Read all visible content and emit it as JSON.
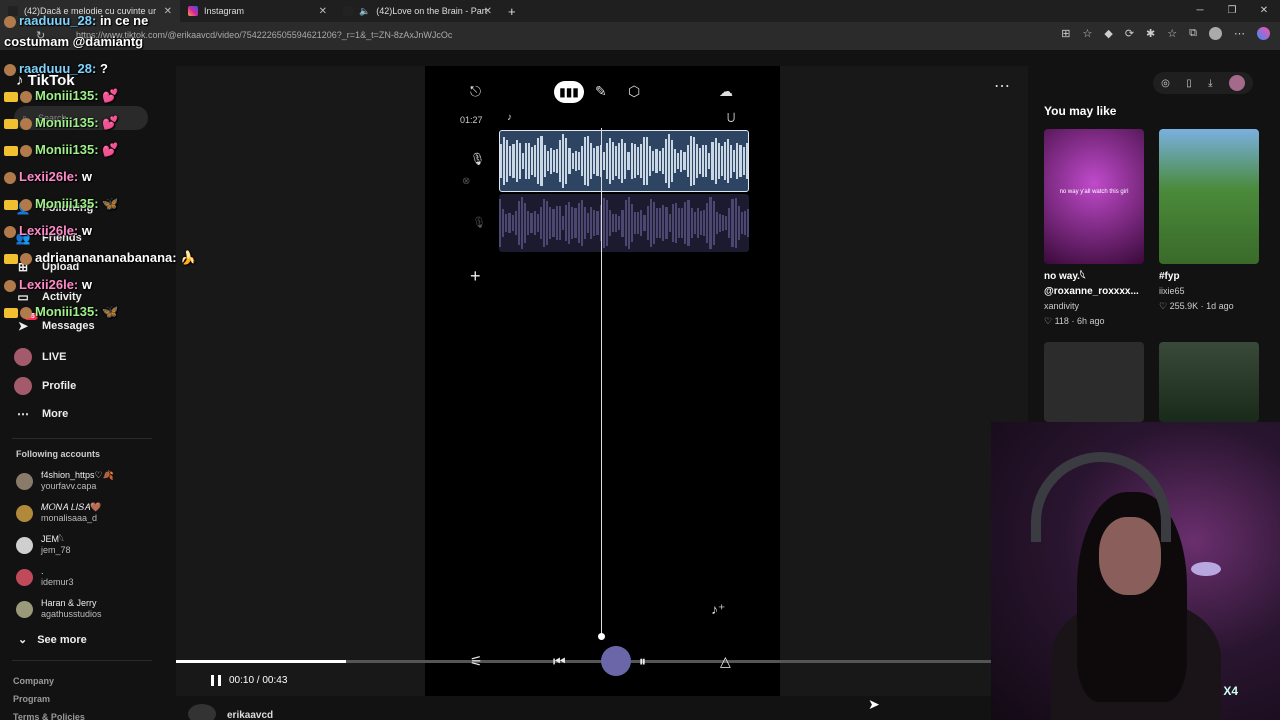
{
  "browser": {
    "tabs": [
      {
        "label": "(42)Dacă e melodie cu cuvinte ur",
        "active": true
      },
      {
        "label": "Instagram",
        "active": false
      },
      {
        "label": "(42)Love on the Brain - Part",
        "active": false
      }
    ],
    "new_tab": "+",
    "url": "https://www.tiktok.com/@erikaavcd/video/7542226505594621206?_r=1&_t=ZN-8zAxJnWJcOc"
  },
  "chat": [
    {
      "user": "raaduuu_28:",
      "msg": "in ce ne",
      "color": "#7fd4ff"
    },
    {
      "user": "costumam @damiantg",
      "msg": "",
      "color": "#ffffff"
    },
    {
      "user": "raaduuu_28:",
      "msg": "?",
      "color": "#7fd4ff"
    },
    {
      "user": "Moniii135:",
      "msg": "💕",
      "color": "#9ef08a"
    },
    {
      "user": "Moniii135:",
      "msg": "💕",
      "color": "#9ef08a"
    },
    {
      "user": "Moniii135:",
      "msg": "💕",
      "color": "#9ef08a"
    },
    {
      "user": "Lexii26le:",
      "msg": "w",
      "color": "#ff8ac8"
    },
    {
      "user": "Moniii135:",
      "msg": "🦋",
      "color": "#9ef08a"
    },
    {
      "user": "Lexii26le:",
      "msg": "w",
      "color": "#ff8ac8"
    },
    {
      "user": "adriananananabanana:",
      "msg": "🍌",
      "color": "#ffffff"
    },
    {
      "user": "Lexii26le:",
      "msg": "w",
      "color": "#ff8ac8"
    },
    {
      "user": "Moniii135:",
      "msg": "🦋",
      "color": "#9ef08a"
    }
  ],
  "sidebar": {
    "logo": "TikTok",
    "search_placeholder": "Search",
    "nav": [
      {
        "label": "Following",
        "icon": "user-icon"
      },
      {
        "label": "Friends",
        "icon": "friends-icon"
      },
      {
        "label": "Upload",
        "icon": "upload-icon"
      },
      {
        "label": "Activity",
        "icon": "activity-icon"
      },
      {
        "label": "Messages",
        "icon": "messages-icon"
      },
      {
        "label": "LIVE",
        "icon": "live-icon"
      },
      {
        "label": "Profile",
        "icon": "profile-icon"
      },
      {
        "label": "More",
        "icon": "more-icon"
      }
    ],
    "messages_badge": "35",
    "following_title": "Following accounts",
    "accounts": [
      {
        "name": "f4shion_https♡🍂",
        "handle": "yourfavv.capa"
      },
      {
        "name": "𝑀𝑂𝑁𝐴 𝐿𝐼𝑆𝐴🤎",
        "handle": "monalisaaa_d"
      },
      {
        "name": "JEM𓆩",
        "handle": "jem_78"
      },
      {
        "name": ".",
        "handle": "idemur3"
      },
      {
        "name": "Haran & Jerry",
        "handle": "agathusstudios"
      }
    ],
    "see_more": "See more",
    "footer": [
      "Company",
      "Program",
      "Terms & Policies"
    ]
  },
  "player": {
    "timecode_top": "01:27",
    "current": "00:10",
    "duration": "00:43",
    "progress": 0.2,
    "author": "erikaavcd"
  },
  "right": {
    "you_may_like": "You may like",
    "videos": [
      {
        "title": "no way.𓆩",
        "subtitle": "@roxanne_roxxxx...",
        "author": "xandivity",
        "stats": "118 · 6h ago",
        "thumb_text": "no way y'all watch this girl",
        "bg": "#7a2a7a"
      },
      {
        "title": "#fyp",
        "subtitle": "",
        "author": "iixie65",
        "stats": "255.9K · 1d ago",
        "thumb_text": "",
        "bg": "#4a7a3a"
      },
      {
        "title": "",
        "subtitle": "",
        "author": "",
        "stats": "",
        "thumb_text": "",
        "bg": "#2a2a2a"
      },
      {
        "title": "",
        "subtitle": "",
        "author": "",
        "stats": "",
        "thumb_text": "",
        "bg": "#3a4a3a"
      }
    ]
  },
  "cam": {
    "badge": "X4"
  }
}
